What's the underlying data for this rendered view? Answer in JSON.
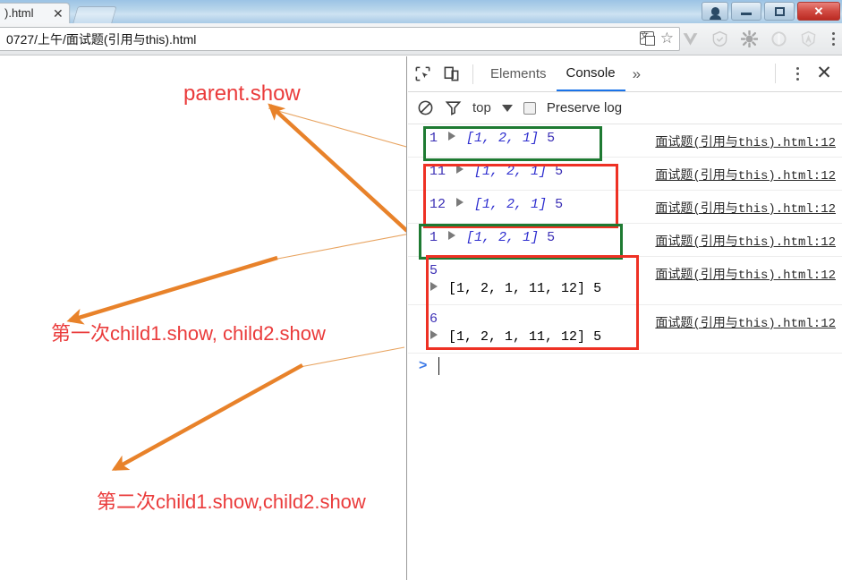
{
  "browser": {
    "tab": {
      "title": ").html",
      "close_label": "✕"
    },
    "new_tab_name": "new-tab-button",
    "window_controls": {
      "user": "user-profile",
      "minimize": "–",
      "maximize": "❐",
      "close": "✕"
    },
    "omnibox": {
      "url": "0727/上午/面试题(引用与this).html",
      "placeholder": ""
    },
    "omnibox_icons": [
      "translate-icon",
      "bookmark-star-icon"
    ],
    "extensions": [
      "vue-devtools-icon",
      "shield-icon",
      "gear-bug-icon",
      "circle-icon",
      "angular-icon"
    ],
    "menu": "chrome-menu-icon"
  },
  "page_annotations": {
    "parent_show": "parent.show",
    "first_call": "第一次child1.show, child2.show",
    "second_call": "第二次child1.show,child2.show",
    "color": "#ea3b3b",
    "arrow_color": "#e8822a"
  },
  "devtools": {
    "inspect_icon": "inspect-element-icon",
    "device_icon": "device-toolbar-icon",
    "tabs": [
      {
        "label": "Elements",
        "active": false
      },
      {
        "label": "Console",
        "active": true
      }
    ],
    "more_tabs": "»",
    "kebab": "devtools-menu-icon",
    "close": "✕",
    "filterbar": {
      "clear_icon": "clear-console-icon",
      "filter_icon": "filter-icon",
      "context": "top",
      "caret": "chevron-down-icon",
      "preserve_log_checked": false,
      "preserve_log_label": "Preserve log"
    },
    "source_link": "面试题(引用与this).html:12",
    "prompt": {
      "caret": ">",
      "value": ""
    },
    "console_rows": [
      {
        "id": "row-1",
        "index": "1",
        "array": "[1, 2, 1]",
        "tail": "5",
        "two_line": false,
        "box": "green"
      },
      {
        "id": "row-2",
        "index": "11",
        "array": "[1, 2, 1]",
        "tail": "5",
        "two_line": false,
        "box": "red"
      },
      {
        "id": "row-3",
        "index": "12",
        "array": "[1, 2, 1]",
        "tail": "5",
        "two_line": false,
        "box": "red"
      },
      {
        "id": "row-4",
        "index": "1",
        "array": "[1, 2, 1]",
        "tail": "5",
        "two_line": false,
        "box": "green"
      },
      {
        "id": "row-5",
        "index": "5",
        "array": "[1, 2, 1, 11, 12]",
        "tail": "5",
        "two_line": true,
        "box": "red"
      },
      {
        "id": "row-6",
        "index": "6",
        "array": "[1, 2, 1, 11, 12]",
        "tail": "5",
        "two_line": true,
        "box": "red"
      }
    ],
    "highlight_colors": {
      "green": "#1e7a32",
      "red": "#ee3124"
    }
  }
}
